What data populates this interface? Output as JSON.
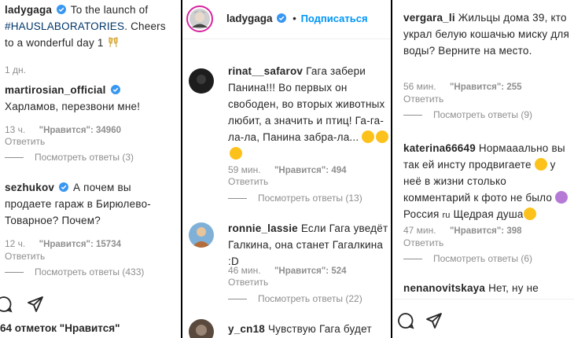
{
  "left": {
    "caption": {
      "username": "ladygaga",
      "text_before": "To the launch of",
      "hashtag": "#HAUSLABORATORIES",
      "text_after": ". Cheers to a wonderful day 1",
      "time": "1 дн."
    },
    "comments": [
      {
        "username": "martirosian_official",
        "text": "Харламов, перезвони мне!",
        "time": "13 ч.",
        "likes": "\"Нравится\": 34960",
        "reply": "Ответить",
        "view_replies": "Посмотреть ответы (3)"
      },
      {
        "username": "sezhukov",
        "text": "А почем вы продаете гараж в Бирюлево-Товарное? Почем?",
        "time": "12 ч.",
        "likes": "\"Нравится\": 15734",
        "reply": "Ответить",
        "view_replies": "Посмотреть ответы (433)"
      }
    ],
    "likes_count": "64 отметок \"Нравится\""
  },
  "center": {
    "header": {
      "username": "ladygaga",
      "separator": "•",
      "follow": "Подписаться"
    },
    "comments": [
      {
        "username": "rinat__safarov",
        "text": "Гага забери Панина!!! Во первых он свободен, во вторых животных любит, а значить и птиц! Га-га-ла-ла, Панина забра-ла...",
        "time": "59 мин.",
        "likes": "\"Нравится\": 494",
        "reply": "Ответить",
        "view_replies": "Посмотреть ответы (13)"
      },
      {
        "username": "ronnie_lassie",
        "text": "Если Гага уведёт Галкина, она станет Гагалкина :D",
        "time": "46 мин.",
        "likes": "\"Нравится\": 524",
        "reply": "Ответить",
        "view_replies": "Посмотреть ответы (22)"
      },
      {
        "username": "y_cn18",
        "text": "Чувствую Гага будет"
      }
    ]
  },
  "right": {
    "comments": [
      {
        "username": "vergara_li",
        "text": "Жильцы дома 39, кто украл белую кошачью миску для воды? Верните на место.",
        "time": "56 мин.",
        "likes": "\"Нравится\": 255",
        "reply": "Ответить",
        "view_replies": "Посмотреть ответы (9)"
      },
      {
        "username": "katerina66649",
        "text_1": "Нормааально вы так ей инсту продвигаете",
        "text_2": "у неё в жизни столько комментарий к фото не было",
        "text_3": "Россия",
        "text_flag": "ru",
        "text_4": "Щедрая душа",
        "time": "47 мин.",
        "likes": "\"Нравится\": 398",
        "reply": "Ответить",
        "view_replies": "Посмотреть ответы (6)"
      },
      {
        "username": "nenanovitskaya",
        "text": "Нет, ну не"
      }
    ]
  },
  "colors": {
    "link": "#0095f6",
    "hashtag": "#003569",
    "muted": "#8e8e8e",
    "verified": "#3897f0"
  }
}
